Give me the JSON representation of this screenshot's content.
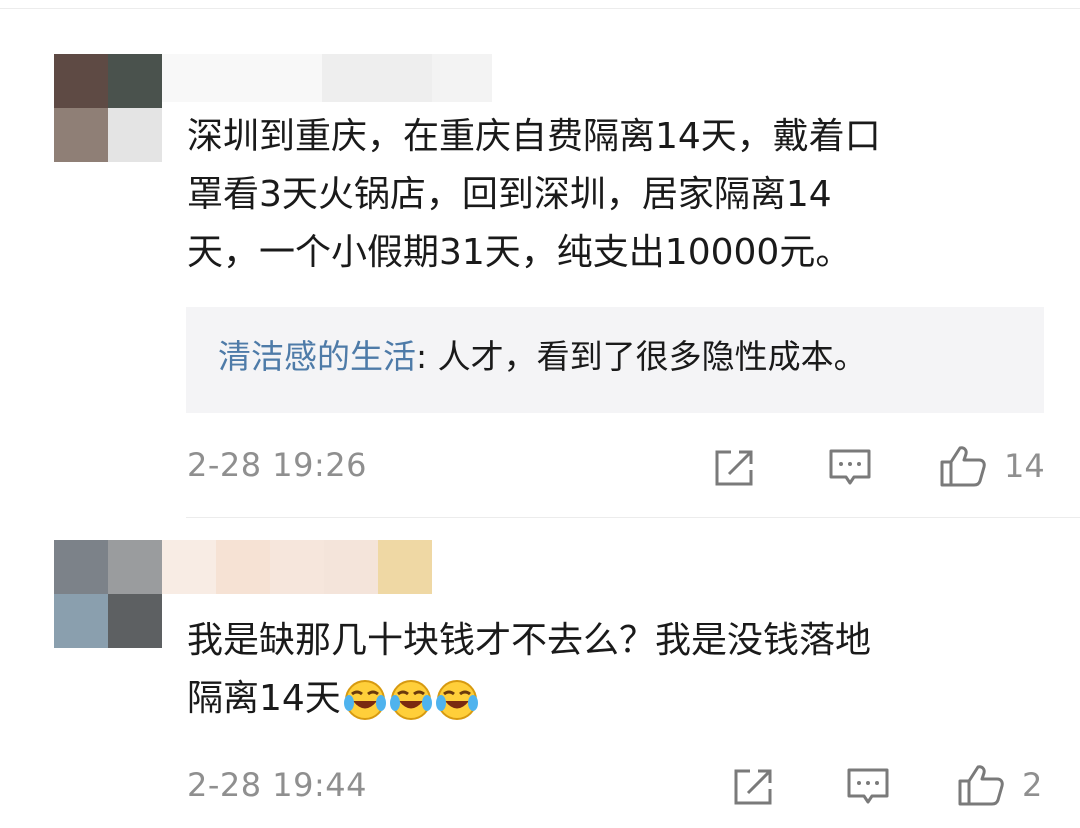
{
  "comments": [
    {
      "text": "深圳到重庆，在重庆自费隔离14天，戴着口\n罩看3天火锅店，回到深圳，居家隔离14\n天，一个小假期31天，纯支出10000元。",
      "reply": {
        "author": "清洁感的生活",
        "separator": ": ",
        "text": "人才，看到了很多隐性成本。"
      },
      "timestamp": "2-28 19:26",
      "like_count": "14",
      "icons": [
        "share-icon",
        "comment-icon",
        "like-icon"
      ]
    },
    {
      "text": "我是缺那几十块钱才不去么？我是没钱落地\n隔离14天",
      "emoji": [
        "crying-laughing-emoji",
        "crying-laughing-emoji",
        "crying-laughing-emoji"
      ],
      "timestamp": "2-28 19:44",
      "like_count": "2",
      "icons": [
        "share-icon",
        "comment-icon",
        "like-icon"
      ]
    }
  ],
  "colors": {
    "reply_author": "#4e7ba8",
    "meta_text": "#8f8f8f",
    "reply_bg": "#f4f4f6",
    "icon_stroke": "#7a7a7a"
  }
}
